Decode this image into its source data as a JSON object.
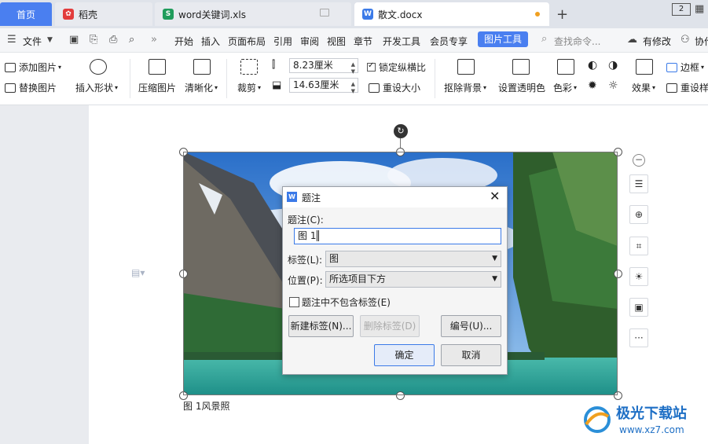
{
  "tabs": {
    "home": "首页",
    "daoke": "稻壳",
    "xls": "word关键词.xls",
    "doc": "散文.docx",
    "window_count": "2"
  },
  "menu": {
    "file": "文件",
    "items": [
      "开始",
      "插入",
      "页面布局",
      "引用",
      "审阅",
      "视图",
      "章节",
      "开发工具",
      "会员专享"
    ],
    "active": "图片工具",
    "search": "查找命令...",
    "modified": "有修改",
    "collab": "协作"
  },
  "ribbon": {
    "add_picture": "添加图片",
    "replace_picture": "替换图片",
    "insert_shape": "插入形状",
    "compress": "压缩图片",
    "sharpen": "清晰化",
    "crop": "裁剪",
    "height": "8.23厘米",
    "width": "14.63厘米",
    "lock_ratio": "锁定纵横比",
    "reset_size": "重设大小",
    "remove_bg": "抠除背景",
    "set_transparent": "设置透明色",
    "color": "色彩",
    "effect": "效果",
    "border": "边框",
    "reset_style": "重设样"
  },
  "document": {
    "caption": "图 1风景照"
  },
  "dialog": {
    "title": "题注",
    "caption_label": "题注(C):",
    "caption_value": "图 1",
    "label_label": "标签(L):",
    "label_value": "图",
    "position_label": "位置(P):",
    "position_value": "所选项目下方",
    "exclude_label": "题注中不包含标签(E)",
    "btn_new_label": "新建标签(N)...",
    "btn_delete_label": "删除标签(D)",
    "btn_numbering": "编号(U)...",
    "btn_ok": "确定",
    "btn_cancel": "取消"
  },
  "watermark": {
    "name": "极光下载站",
    "url": "www.xz7.com"
  },
  "colors": {
    "accent": "#4a7ff0",
    "dialog_accent": "#3b7ae8",
    "modified_dot": "#f0a020"
  },
  "icons": [
    "close-icon",
    "plus-icon",
    "search-icon",
    "rotate-icon",
    "zoom-in-icon",
    "crop-icon",
    "bulb-icon",
    "chevron-down-icon"
  ]
}
